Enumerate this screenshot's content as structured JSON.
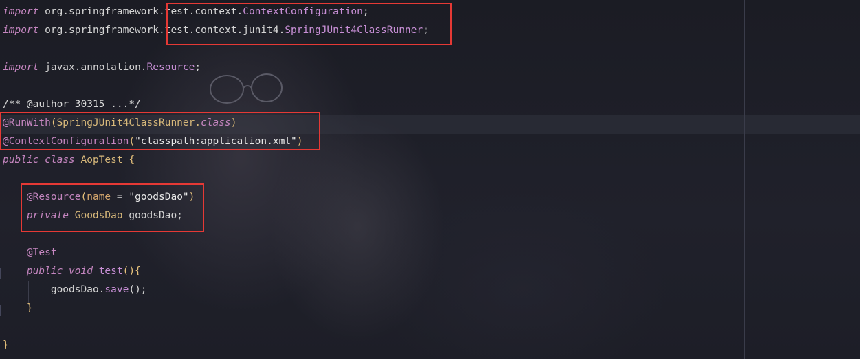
{
  "editor": {
    "lines": [
      [
        {
          "t": "import",
          "c": "kw"
        },
        {
          "t": " org.springframework.",
          "c": "pkg"
        },
        {
          "t": "test.context.",
          "c": "pkg"
        },
        {
          "t": "ContextConfiguration",
          "c": "cls"
        },
        {
          "t": ";",
          "c": "punct"
        }
      ],
      [
        {
          "t": "import",
          "c": "kw"
        },
        {
          "t": " org.springframework.",
          "c": "pkg"
        },
        {
          "t": "test.context.junit4.",
          "c": "pkg"
        },
        {
          "t": "SpringJUnit4ClassRunner",
          "c": "cls"
        },
        {
          "t": ";",
          "c": "punct"
        }
      ],
      [],
      [
        {
          "t": "import",
          "c": "kw"
        },
        {
          "t": " javax.annotation.",
          "c": "pkg"
        },
        {
          "t": "Resource",
          "c": "cls"
        },
        {
          "t": ";",
          "c": "punct"
        }
      ],
      [],
      [
        {
          "t": "/** @author 30315 ...*/",
          "c": "cmt"
        }
      ],
      [
        {
          "t": "@RunWith",
          "c": "ann"
        },
        {
          "t": "(",
          "c": "yel"
        },
        {
          "t": "SpringJUnit4ClassRunner.",
          "c": "cls2"
        },
        {
          "t": "class",
          "c": "kw2"
        },
        {
          "t": ")",
          "c": "yel"
        }
      ],
      [
        {
          "t": "@ContextConfiguration",
          "c": "ann"
        },
        {
          "t": "(",
          "c": "yel"
        },
        {
          "t": "\"classpath:application.xml\"",
          "c": "str"
        },
        {
          "t": ")",
          "c": "yel"
        }
      ],
      [
        {
          "t": "public",
          "c": "kwclass"
        },
        {
          "t": " ",
          "c": "punct"
        },
        {
          "t": "class",
          "c": "kwclass"
        },
        {
          "t": " AopTest ",
          "c": "cls2"
        },
        {
          "t": "{",
          "c": "yel"
        }
      ],
      [],
      [
        {
          "t": "    ",
          "c": "punct"
        },
        {
          "t": "@Resource",
          "c": "ann"
        },
        {
          "t": "(",
          "c": "yel"
        },
        {
          "t": "name",
          "c": "param"
        },
        {
          "t": " = ",
          "c": "punct"
        },
        {
          "t": "\"goodsDao\"",
          "c": "str"
        },
        {
          "t": ")",
          "c": "yel"
        }
      ],
      [
        {
          "t": "    ",
          "c": "punct"
        },
        {
          "t": "private",
          "c": "kwclass"
        },
        {
          "t": " GoodsDao ",
          "c": "cls2"
        },
        {
          "t": "goodsDao;",
          "c": "punct"
        }
      ],
      [],
      [
        {
          "t": "    ",
          "c": "punct"
        },
        {
          "t": "@Test",
          "c": "ann"
        }
      ],
      [
        {
          "t": "    ",
          "c": "punct"
        },
        {
          "t": "public",
          "c": "kwclass"
        },
        {
          "t": " ",
          "c": "punct"
        },
        {
          "t": "void",
          "c": "kwclass"
        },
        {
          "t": " ",
          "c": "punct"
        },
        {
          "t": "test",
          "c": "fn"
        },
        {
          "t": "(){",
          "c": "yel"
        }
      ],
      [
        {
          "t": "        ",
          "c": "punct"
        },
        {
          "t": "goodsDao.",
          "c": "punct"
        },
        {
          "t": "save",
          "c": "fn"
        },
        {
          "t": "();",
          "c": "punct"
        }
      ],
      [
        {
          "t": "    ",
          "c": "punct"
        },
        {
          "t": "}",
          "c": "yel"
        }
      ],
      [],
      [
        {
          "t": "}",
          "c": "yel"
        }
      ]
    ]
  },
  "highlights": [
    {
      "name": "highlight-imports"
    },
    {
      "name": "highlight-annotations"
    },
    {
      "name": "highlight-resource-field"
    }
  ],
  "colors": {
    "highlight_border": "#e53935"
  }
}
